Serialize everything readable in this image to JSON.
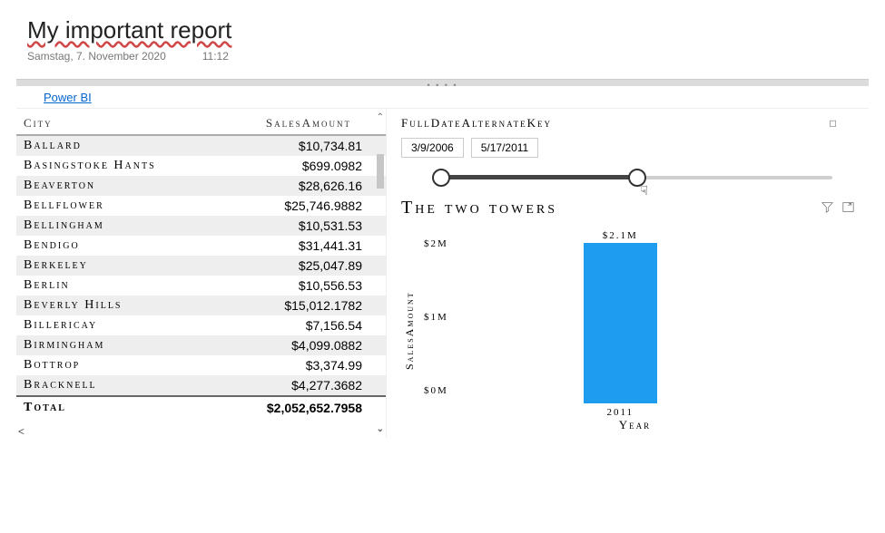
{
  "header": {
    "title": "My important report",
    "date": "Samstag, 7. November 2020",
    "time": "11:12"
  },
  "link": {
    "label": "Power BI"
  },
  "table": {
    "columns": {
      "city": "City",
      "sales": "SalesAmount"
    },
    "rows": [
      {
        "city": "Ballard",
        "sales": "$10,734.81"
      },
      {
        "city": "Basingstoke Hants",
        "sales": "$699.0982"
      },
      {
        "city": "Beaverton",
        "sales": "$28,626.16"
      },
      {
        "city": "Bellflower",
        "sales": "$25,746.9882"
      },
      {
        "city": "Bellingham",
        "sales": "$10,531.53"
      },
      {
        "city": "Bendigo",
        "sales": "$31,441.31"
      },
      {
        "city": "Berkeley",
        "sales": "$25,047.89"
      },
      {
        "city": "Berlin",
        "sales": "$10,556.53"
      },
      {
        "city": "Beverly Hills",
        "sales": "$15,012.1782"
      },
      {
        "city": "Billericay",
        "sales": "$7,156.54"
      },
      {
        "city": "Birmingham",
        "sales": "$4,099.0882"
      },
      {
        "city": "Bottrop",
        "sales": "$3,374.99"
      },
      {
        "city": "Bracknell",
        "sales": "$4,277.3682"
      }
    ],
    "total": {
      "label": "Total",
      "value": "$2,052,652.7958"
    }
  },
  "slicer": {
    "title": "FullDateAlternateKey",
    "start": "3/9/2006",
    "end": "5/17/2011",
    "eraser_icon": "eraser-icon"
  },
  "chart": {
    "title": "The two towers",
    "filter_icon": "filter-icon",
    "focus_icon": "focus-icon"
  },
  "chart_data": {
    "type": "bar",
    "title": "The two towers",
    "xlabel": "Year",
    "ylabel": "SalesAmount",
    "ylim": [
      0,
      2100000
    ],
    "yticks": [
      "$2M",
      "$1M",
      "$0M"
    ],
    "categories": [
      "2011"
    ],
    "values": [
      2100000
    ],
    "value_labels": [
      "$2.1M"
    ]
  }
}
